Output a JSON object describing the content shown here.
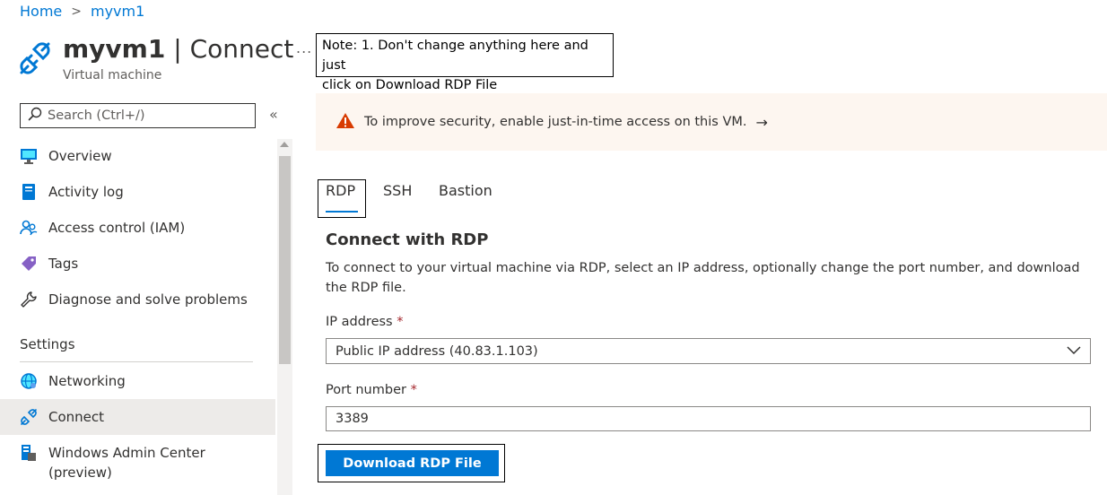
{
  "breadcrumb": {
    "home": "Home",
    "current": "myvm1"
  },
  "header": {
    "resource_name": "myvm1",
    "separator": " | ",
    "blade_title": "Connect",
    "subtitle": "Virtual machine",
    "more_label": "..."
  },
  "note": {
    "line1": "Note: 1. Don't change anything here and just",
    "line2": "click on Download RDP File"
  },
  "search": {
    "placeholder": "Search (Ctrl+/)"
  },
  "collapse_label": "«",
  "sidebar": {
    "items": [
      {
        "label": "Overview",
        "icon": "monitor-icon"
      },
      {
        "label": "Activity log",
        "icon": "log-book-icon"
      },
      {
        "label": "Access control (IAM)",
        "icon": "people-icon"
      },
      {
        "label": "Tags",
        "icon": "tag-icon"
      },
      {
        "label": "Diagnose and solve problems",
        "icon": "wrench-icon"
      }
    ],
    "section_settings": "Settings",
    "settings_items": [
      {
        "label": "Networking",
        "icon": "globe-network-icon"
      },
      {
        "label": "Connect",
        "icon": "plug-icon",
        "active": true
      },
      {
        "label": "Windows Admin Center",
        "label2": "(preview)",
        "icon": "server-icon"
      }
    ]
  },
  "banner": {
    "text": "To improve security, enable just-in-time access on this VM.",
    "arrow": "→"
  },
  "tabs": [
    {
      "label": "RDP",
      "selected": true
    },
    {
      "label": "SSH"
    },
    {
      "label": "Bastion"
    }
  ],
  "connect": {
    "heading": "Connect with RDP",
    "description": "To connect to your virtual machine via RDP, select an IP address, optionally change the port number, and download the RDP file.",
    "ip_label": "IP address",
    "ip_value": "Public IP address (40.83.1.103)",
    "port_label": "Port number",
    "port_value": "3389",
    "required_mark": "*",
    "download_label": "Download RDP File"
  },
  "colors": {
    "accent": "#0078d4",
    "warning": "#d83b01",
    "active_nav": "#edebe9",
    "banner_bg": "#fdf6f0"
  }
}
